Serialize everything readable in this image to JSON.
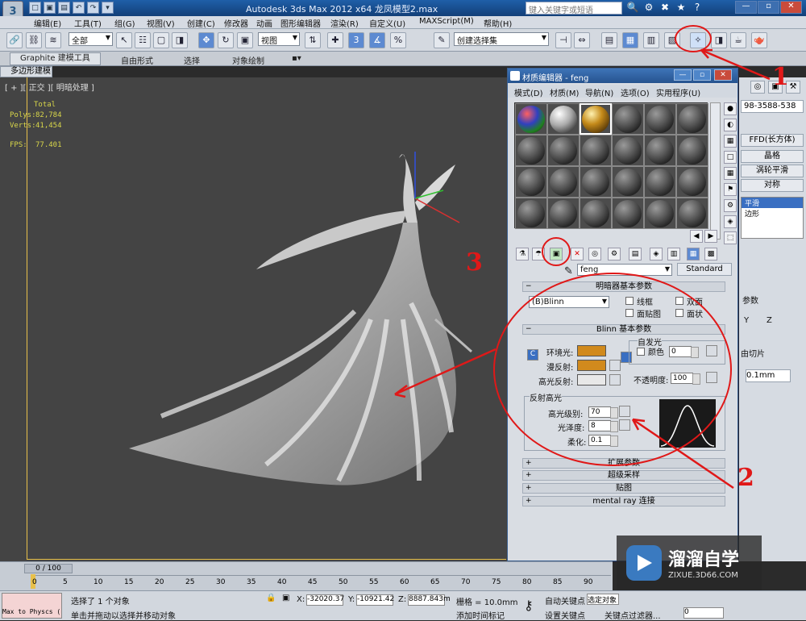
{
  "app": {
    "title": "Autodesk 3ds Max  2012 x64      龙凤模型2.max",
    "logo": "3",
    "search_placeholder": "键入关键字或短语",
    "quick_access": [
      "□",
      "▣",
      "▤",
      "↶",
      "↷",
      "▾"
    ],
    "title_tools": [
      "🔍",
      "⚙",
      "✖",
      "★",
      "?"
    ],
    "window_buttons": [
      "—",
      "▫",
      "✕"
    ]
  },
  "menubar": [
    "编辑(E)",
    "工具(T)",
    "组(G)",
    "视图(V)",
    "创建(C)",
    "修改器",
    "动画",
    "图形编辑器",
    "渲染(R)",
    "自定义(U)",
    "MAXScript(M)",
    "帮助(H)"
  ],
  "toolbar": {
    "selection_filter": "全部",
    "ref_coord": "视图",
    "named_selection": "创建选择集",
    "left_buttons": [
      "🔗",
      "⛓",
      "≋"
    ],
    "select_buttons": [
      "↖",
      "☷",
      "▢",
      "◨",
      "✥",
      "↻",
      "▣"
    ],
    "snap_buttons": [
      "✚",
      "3",
      "∡",
      "%",
      "⇅"
    ],
    "edit_buttons": [
      "✎"
    ],
    "right_buttons": [
      "⊣",
      "⇔",
      "▤",
      "▦",
      "▥",
      "▧",
      "✧",
      "◨",
      "☕",
      "🫖"
    ]
  },
  "ribbon": {
    "tabs": [
      "Graphite 建模工具",
      "自由形式",
      "选择",
      "对象绘制"
    ],
    "extra": "▪▾",
    "sub": "多边形建模"
  },
  "viewport": {
    "label": "[ + ][ 正交 ][ 明暗处理 ]",
    "stats": {
      "total": "Total",
      "polys_label": "Polys:",
      "polys": "82,784",
      "verts_label": "Verts:",
      "verts": "41,454",
      "fps_label": "FPS:",
      "fps": "77.401"
    }
  },
  "command_panel": {
    "tabs": [
      "◎",
      "▣",
      "⚒"
    ],
    "name_field": "98-3588-538",
    "buttons": [
      "FFD(长方体)",
      "晶格",
      "涡轮平滑",
      "对称"
    ],
    "stack_items": [
      "平滑",
      "边形"
    ],
    "section": "参数",
    "axis_y": "Y",
    "axis_z": "Z",
    "slice_label": "由切片",
    "value": "0.1mm"
  },
  "material_editor": {
    "title": "材质编辑器 - feng",
    "window_buttons": [
      "—",
      "▫",
      "✕"
    ],
    "menu": [
      "模式(D)",
      "材质(M)",
      "导航(N)",
      "选项(O)",
      "实用程序(U)"
    ],
    "side_tools": [
      "●",
      "◐",
      "▦",
      "□",
      "▦",
      "⚑",
      "⚙",
      "◈",
      "⬚"
    ],
    "bottom_tools": [
      "⚗",
      "☂",
      "▣",
      "✕",
      "◎",
      "⚙",
      "▤",
      "◈",
      "▥",
      "▦",
      "▩"
    ],
    "nav_tools": [
      "◀",
      "▶"
    ],
    "material_name": "feng",
    "material_type": "Standard",
    "shader_rollout": "明暗器基本参数",
    "shader": "(B)Blinn",
    "shader_options": [
      "线框",
      "双面",
      "面贴图",
      "面状"
    ],
    "blinn_rollout": "Blinn 基本参数",
    "ambient_label": "环境光:",
    "diffuse_label": "漫反射:",
    "specular_label": "高光反射:",
    "lock_icon": "C",
    "self_illum_group": "自发光",
    "color_label": "颜色",
    "self_illum_value": "0",
    "opacity_label": "不透明度:",
    "opacity_value": "100",
    "highlights_group": "反射高光",
    "spec_level_label": "高光级别:",
    "spec_level": "70",
    "gloss_label": "光泽度:",
    "gloss": "8",
    "soften_label": "柔化:",
    "soften": "0.1",
    "rollouts": [
      "扩展参数",
      "超级采样",
      "贴图",
      "mental ray 连接"
    ],
    "colors": {
      "ambient": "#d18a1d",
      "diffuse": "#d18a1d",
      "specular": "#e8e8e8"
    }
  },
  "timeline": {
    "frame": "0 / 100",
    "ticks": [
      "0",
      "5",
      "10",
      "15",
      "20",
      "25",
      "30",
      "35",
      "40",
      "45",
      "50",
      "55",
      "60",
      "65",
      "70",
      "75",
      "80",
      "85",
      "90"
    ]
  },
  "statusbar": {
    "script_prompt": "Max to Physcs (",
    "status1": "选择了 1 个对象",
    "status2": "单击并拖动以选择并移动对象",
    "x_label": "X:",
    "x": "-32020.37",
    "y_label": "Y:",
    "y": "-10921.42",
    "z_label": "Z:",
    "z": "8887.843m",
    "grid": "栅格 = 10.0mm",
    "add_time_tag": "添加时间标记",
    "auto_key": "自动关键点",
    "selected": "选定对象",
    "set_key": "设置关键点",
    "key_filter": "关键点过滤器...",
    "frame_value": "0"
  },
  "watermark": {
    "name": "溜溜自学",
    "url": "ZIXUE.3D66.COM"
  },
  "annotations": [
    "1",
    "2",
    "3"
  ]
}
